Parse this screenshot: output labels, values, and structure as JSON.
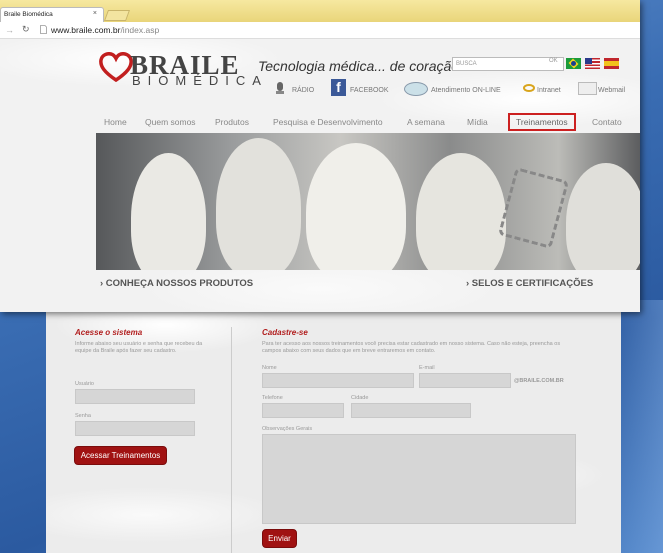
{
  "browser": {
    "tab_title": "Braile Biomédica",
    "tab_close": "×",
    "url_host": "www.braile.com.br",
    "url_path": "/index.asp"
  },
  "header": {
    "logo_text": "BRAILE",
    "logo_sub": "BIOMÉDICA",
    "tagline": "Tecnologia médica... de coração!",
    "search_placeholder": "BUSCA",
    "search_ok": "OK",
    "links": {
      "radio": "RÁDIO",
      "facebook": "FACEBOOK",
      "atendimento": "Atendimento ON-LINE",
      "intranet": "Intranet",
      "webmail": "Webmail"
    }
  },
  "nav": {
    "home": "Home",
    "quem_somos": "Quem somos",
    "produtos": "Produtos",
    "pesquisa": "Pesquisa e Desenvolvimento",
    "semana": "A semana",
    "midia": "Mídia",
    "treinamentos": "Treinamentos",
    "contato": "Contato"
  },
  "banners": {
    "produtos": "› CONHEÇA NOSSOS PRODUTOS",
    "selos": "› SELOS E CERTIFICAÇÕES"
  },
  "login": {
    "title": "Acesse o sistema",
    "desc": "Informe abaixo seu usuário e senha que recebeu da equipe da Braile após fazer seu cadastro.",
    "user_label": "Usuário",
    "pass_label": "Senha",
    "button": "Acessar Treinamentos"
  },
  "signup": {
    "title": "Cadastre-se",
    "desc": "Para ter acesso aos nossos treinamentos você precisa estar cadastrado em nosso sistema. Caso não esteja, preencha os campos abaixo com seus dados que em breve entraremos em contato.",
    "name_label": "Nome",
    "email_label": "E-mail",
    "email_domain": "@BRAILE.COM.BR",
    "phone_label": "Telefone",
    "city_label": "Cidade",
    "notes_label": "Observações Gerais",
    "button": "Enviar"
  },
  "colors": {
    "accent_red": "#a01212",
    "nav_highlight": "#cc2020"
  }
}
